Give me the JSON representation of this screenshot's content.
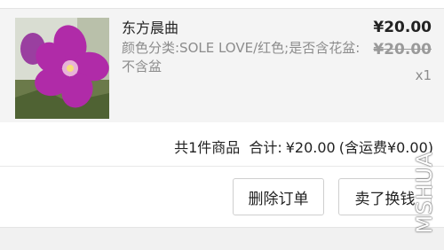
{
  "item": {
    "title": "东方晨曲",
    "spec": "颜色分类:SOLE LOVE/红色;是否含花盆:不含盆",
    "price": "¥20.00",
    "original_price": "¥20.00",
    "quantity": "x1",
    "thumbnail_icon": "flower-photo"
  },
  "summary": {
    "count_text": "共1件商品",
    "total_label": "合计:",
    "total_value": "¥20.00",
    "shipping_text": "(含运费¥0.00)"
  },
  "actions": {
    "delete_label": "删除订单",
    "buy_label": "卖了换钱"
  },
  "watermark": "MSHUA",
  "colors": {
    "item_background": "#f4f4f4",
    "muted_text": "#8c8c8c",
    "flower": "#b02ba8"
  }
}
